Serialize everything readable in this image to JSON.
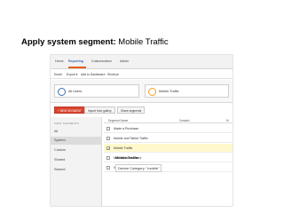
{
  "heading": {
    "bold": "Apply system segment:",
    "normal": "Mobile Traffic"
  },
  "topnav": {
    "tabs": [
      "Home",
      "Reporting",
      "Customization",
      "Admin"
    ],
    "active": "Reporting"
  },
  "toolbar": {
    "items": [
      "Email",
      "Export ▾",
      "Add to Dashboard",
      "Shortcut"
    ]
  },
  "segments": [
    {
      "label": "All Users",
      "color": "#3b6fb5"
    },
    {
      "label": "Mobile Traffic",
      "color": "#f0a020"
    }
  ],
  "buttons": {
    "new": "+ NEW SEGMENT",
    "import": "Import from gallery",
    "share": "Share segments"
  },
  "sidebar": {
    "title": "VIEW SEGMENTS",
    "items": [
      "All",
      "System",
      "Custom",
      "Shared",
      "Starred"
    ],
    "selected": "System"
  },
  "table": {
    "headers": [
      "Segment Name",
      "Created",
      "M"
    ],
    "rows": [
      {
        "name": "Made a Purchase",
        "checked": false
      },
      {
        "name": "Mobile and Tablet Traffic",
        "checked": false
      },
      {
        "name": "Mobile Traffic",
        "checked": true
      },
      {
        "name": "Multi-session Users",
        "checked": false
      },
      {
        "name": "New Users",
        "checked": false
      }
    ]
  },
  "popup": {
    "title": "Mobile Traffic",
    "condition": "Device Category: \"mobile\""
  }
}
